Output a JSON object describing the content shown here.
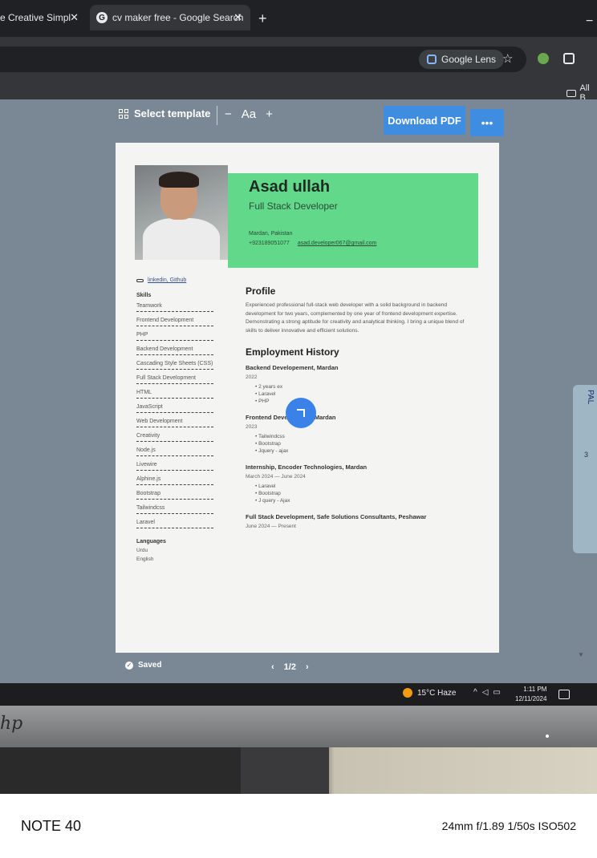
{
  "browser": {
    "tabs": [
      {
        "label": "e Creative Simpl",
        "close": "✕"
      },
      {
        "label": "cv maker free - Google Search",
        "close": "✕"
      }
    ],
    "new_tab": "+",
    "minimize": "−",
    "lens_label": "Google Lens",
    "star": "☆",
    "bookmarks_label": "All B"
  },
  "app": {
    "select_template": "Select template",
    "font_minus": "−",
    "font_label": "Aa",
    "font_plus": "+",
    "download_pdf": "Download PDF",
    "more": "•••",
    "saved": "Saved",
    "page_prev": "‹",
    "page_indicator": "1/2",
    "page_next": "›",
    "side_card_text": "PAL",
    "side_card_number": "3",
    "accent": "#3f8de0"
  },
  "resume": {
    "name": "Asad ullah",
    "role": "Full Stack Developer",
    "location": "Mardan, Pakistan",
    "phone": "+923189051077",
    "email": "asad.developer067@gmail.com",
    "links": "linkedin, Github",
    "skills_title": "Skills",
    "skills": [
      "Teamwork",
      "Frontend Development",
      "PHP",
      "Backend Development",
      "Cascading Style Sheets (CSS)",
      "Full Stack Development",
      "HTML",
      "JavaScript",
      "Web Development",
      "Creativity",
      "Node.js",
      "Livewire",
      "Alphine.js",
      "Bootstrap",
      "Tailwindcss",
      "Laravel"
    ],
    "languages_title": "Languages",
    "languages": [
      "Urdu",
      "English"
    ],
    "profile_title": "Profile",
    "profile_text": "Experienced professional full-stack web developer with a solid background in backend development for two years, complemented by one year of frontend development expertise. Demonstrating a strong aptitude for creativity and analytical thinking. I bring a unique blend of skills to deliver innovative and efficient solutions.",
    "employment_title": "Employment History",
    "jobs": [
      {
        "title": "Backend Developement, Mardan",
        "date": "2022",
        "bullets": [
          "2 years ex",
          "Laravel",
          "PHP"
        ]
      },
      {
        "title": "Frontend Development, Mardan",
        "date": "2023",
        "bullets": [
          "Tailwindcss",
          "Bootstrap",
          "Jquery - ajax"
        ]
      },
      {
        "title": "Internship, Encoder Technologies, Mardan",
        "date": "March 2024 — June 2024",
        "bullets": [
          "Laravel",
          "Bootstrap",
          "J query - Ajax"
        ]
      },
      {
        "title": "Full Stack Development, Safe Solutions Consultants, Peshawar",
        "date": "June 2024 — Present",
        "bullets": []
      }
    ],
    "band_color": "#62d98a"
  },
  "taskbar": {
    "weather": "15°C  Haze",
    "time": "1:11 PM",
    "date": "12/11/2024"
  },
  "monitor": {
    "brand": "hp"
  },
  "camera": {
    "model": "NOTE 40",
    "exif": "24mm f/1.89 1/50s ISO502"
  }
}
